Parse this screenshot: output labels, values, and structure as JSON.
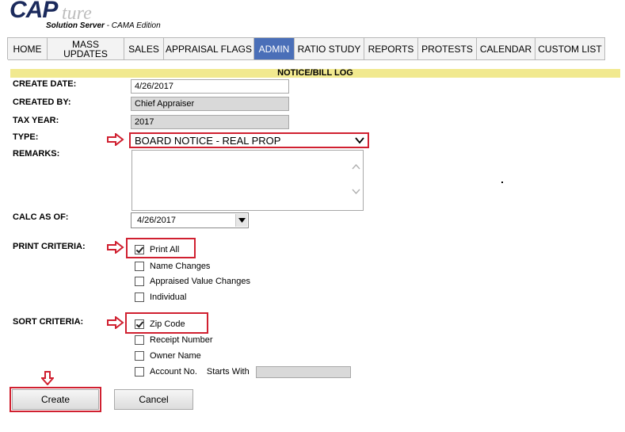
{
  "logo": {
    "cap": "CAP",
    "ture": "ture",
    "subtitle_bold": "Solution Server",
    "subtitle_rest": " - CAMA Edition"
  },
  "nav": {
    "tabs": [
      {
        "label": "HOME",
        "width": 50
      },
      {
        "label": "MASS UPDATES",
        "width": 97
      },
      {
        "label": "SALES",
        "width": 50
      },
      {
        "label": "APPRAISAL FLAGS",
        "width": 114
      },
      {
        "label": "ADMIN",
        "width": 51
      },
      {
        "label": "RATIO STUDY",
        "width": 88
      },
      {
        "label": "REPORTS",
        "width": 68
      },
      {
        "label": "PROTESTS",
        "width": 74
      },
      {
        "label": "CALENDAR",
        "width": 74
      },
      {
        "label": "CUSTOM LIST",
        "width": 88
      }
    ],
    "active": "ADMIN"
  },
  "log_title": "NOTICE/BILL LOG",
  "form": {
    "create_date_label": "CREATE DATE:",
    "create_date_value": "4/26/2017",
    "created_by_label": "CREATED BY:",
    "created_by_value": "Chief Appraiser",
    "tax_year_label": "TAX YEAR:",
    "tax_year_value": "2017",
    "type_label": "TYPE:",
    "type_value": "BOARD NOTICE - REAL PROP",
    "remarks_label": "REMARKS:",
    "calc_label": "CALC AS OF:",
    "calc_value": "4/26/2017",
    "print_label": "PRINT CRITERIA:",
    "print_options": [
      {
        "label": "Print All",
        "checked": true
      },
      {
        "label": "Name Changes",
        "checked": false
      },
      {
        "label": "Appraised Value Changes",
        "checked": false
      },
      {
        "label": "Individual",
        "checked": false
      }
    ],
    "sort_label": "SORT CRITERIA:",
    "sort_options": [
      {
        "label": "Zip Code",
        "checked": true
      },
      {
        "label": "Receipt Number",
        "checked": false
      },
      {
        "label": "Owner Name",
        "checked": false
      },
      {
        "label": "Account No.",
        "checked": false
      }
    ],
    "starts_with_label": "Starts With",
    "create_button": "Create",
    "cancel_button": "Cancel"
  },
  "colors": {
    "highlight": "#d02030",
    "active_tab": "#4a6fb8",
    "log_bar": "#f1e98f"
  }
}
